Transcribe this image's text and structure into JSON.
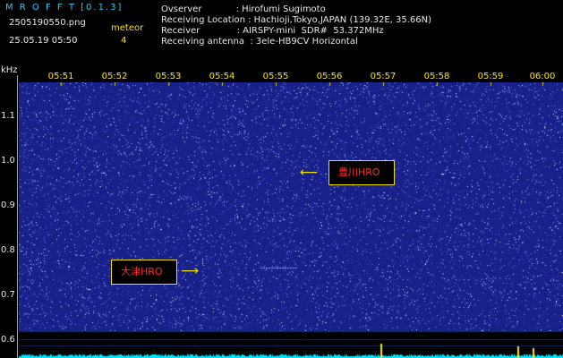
{
  "header": {
    "app_title": "M R O F F T [0.1.3]",
    "filename": "2505190550.png",
    "datetime": "25.05.19 05:50",
    "meteor_label": "meteor",
    "meteor_count": "4"
  },
  "info": {
    "observer": "Ovserver            : Hirofumi Sugimoto",
    "location": "Receiving Location : Hachioji,Tokyo,JAPAN (139.32E, 35.66N)",
    "receiver": "Receiver             : AIRSPY-mini  SDR#  53.372MHz",
    "antenna": "Receiving antenna  : 3ele-HB9CV Horizontal"
  },
  "axis": {
    "y_unit": "kHz",
    "x_ticks": [
      "05:51",
      "05:52",
      "05:53",
      "05:54",
      "05:55",
      "05:56",
      "05:57",
      "05:58",
      "05:59",
      "06:00"
    ],
    "y_ticks": [
      "1.1",
      "1.0",
      "0.9",
      "0.8",
      "0.7",
      "0.6"
    ]
  },
  "annotations": {
    "toyokawa": "豊川HRO",
    "otsu": "大津HRO"
  },
  "colors": {
    "background": "#000000",
    "spectrogram": "#18208a",
    "noise": "#7fa0ff",
    "label_text": "#ff2a2a",
    "label_border": "#f0e000",
    "tick_yellow": "#ffe600",
    "info_cyan": "#2fc9f5",
    "trace": "#00e5ff"
  }
}
